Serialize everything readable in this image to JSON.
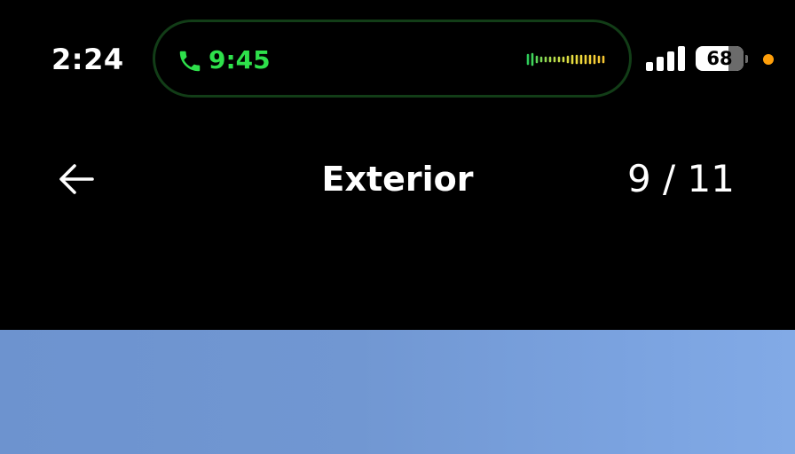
{
  "status_bar": {
    "time": "2:24",
    "call": {
      "duration": "9:45",
      "icon": "phone-icon",
      "accent_color": "#2ee04b"
    },
    "signal_icon": "cellular-signal-icon",
    "battery": {
      "level": "68",
      "fraction": 0.68
    },
    "privacy_indicator_color": "#ff9f0a"
  },
  "header": {
    "back_icon": "arrow-left-icon",
    "title": "Exterior",
    "counter": "9 / 11",
    "current_photo": 9,
    "total_photos": 11
  },
  "photo": {
    "description_color": "#7198d3"
  }
}
